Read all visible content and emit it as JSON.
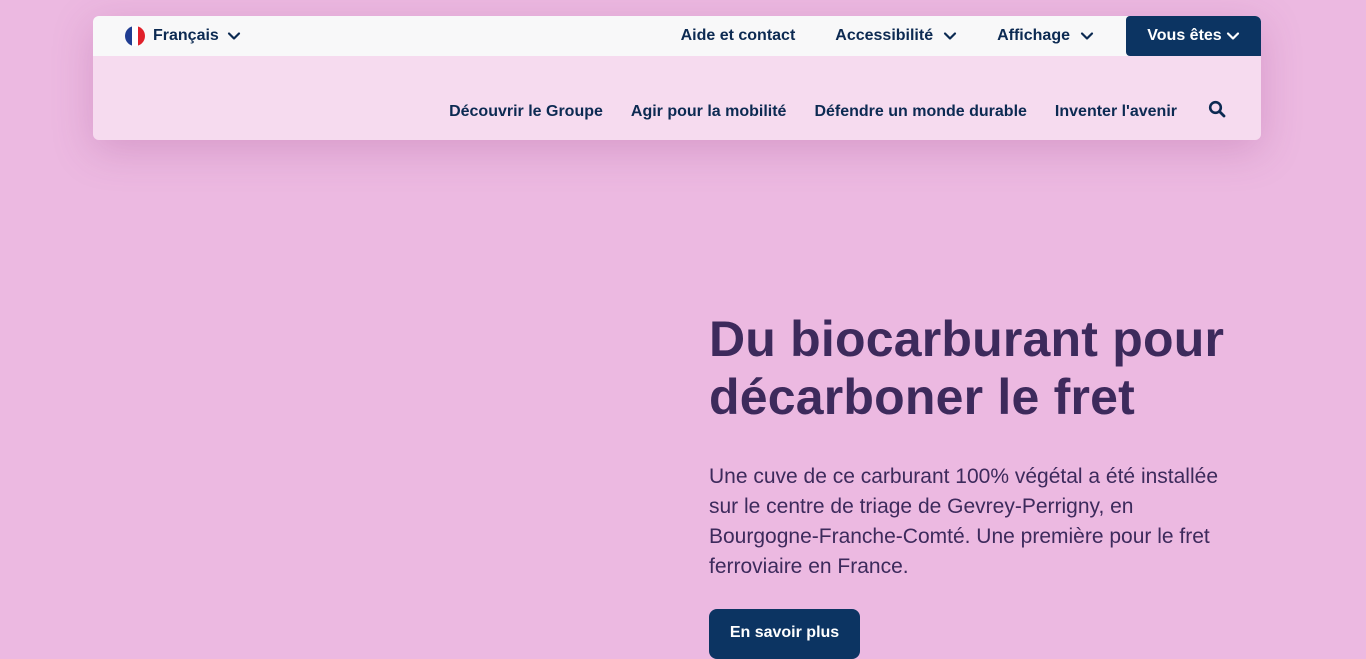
{
  "colors": {
    "background": "#ecb9e1",
    "topbar": "#f8f8f9",
    "mainbar": "#f6dbef",
    "navy": "#0c3462",
    "heading": "#3d2a5c",
    "flag_blue": "#1f3c91",
    "flag_white": "#ffffff",
    "flag_red": "#e0202a"
  },
  "topbar": {
    "language": {
      "label": "Français",
      "icon": "france-flag-icon"
    },
    "links": [
      {
        "label": "Aide et contact"
      },
      {
        "label": "Accessibilité",
        "icon": "chevron-down-icon"
      },
      {
        "label": "Affichage",
        "icon": "chevron-down-icon"
      }
    ],
    "vous_etes": {
      "label": "Vous êtes",
      "icon": "chevron-down-icon"
    }
  },
  "main_nav": {
    "items": [
      {
        "label": "Découvrir le Groupe"
      },
      {
        "label": "Agir pour la mobilité"
      },
      {
        "label": "Défendre un monde durable"
      },
      {
        "label": "Inventer l'avenir"
      }
    ],
    "search_icon": "search-icon"
  },
  "hero": {
    "title": "Du biocarburant pour décarboner le fret",
    "description": "Une cuve de ce carburant 100% végétal a été installée sur le centre de triage de Gevrey-Perrigny, en Bourgogne-Franche-Comté. Une première pour le fret ferroviaire en France.",
    "cta_label": "En savoir plus"
  }
}
